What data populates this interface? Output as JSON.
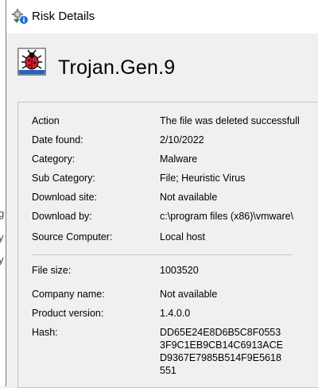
{
  "window": {
    "title": "Risk Details",
    "icon": "risk-details-app-icon"
  },
  "header": {
    "threat_name": "Trojan.Gen.9",
    "icon": "red-bug-icon"
  },
  "details": {
    "action_label": "Action",
    "action_value": "The file was deleted successfull",
    "date_label": "Date found:",
    "date_value": "2/10/2022",
    "category_label": "Category:",
    "category_value": "Malware",
    "subcategory_label": "Sub Category:",
    "subcategory_value": "File; Heuristic Virus",
    "download_site_label": "Download site:",
    "download_site_value": "Not available",
    "download_by_label": "Download by:",
    "download_by_value": "c:\\program files (x86)\\vmware\\",
    "source_label": "Source Computer:",
    "source_value": "Local host",
    "filesize_label": "File size:",
    "filesize_value": "1003520",
    "company_label": "Company name:",
    "company_value": "Not available",
    "version_label": "Product version:",
    "version_value": "1.4.0.0",
    "hash_label": "Hash:",
    "hash_lines": [
      "DD65E24E8D6B5C8F0553",
      "3F9C1EB9CB14C6913ACE",
      "D9367E7985B514F9E5618",
      "551"
    ]
  },
  "background_window": {
    "glyphs": [
      "g",
      "y",
      "y"
    ]
  },
  "colors": {
    "bug_red": "#d9202a",
    "border": "#c8c8c8",
    "window_bg": "#f0f0f0"
  }
}
